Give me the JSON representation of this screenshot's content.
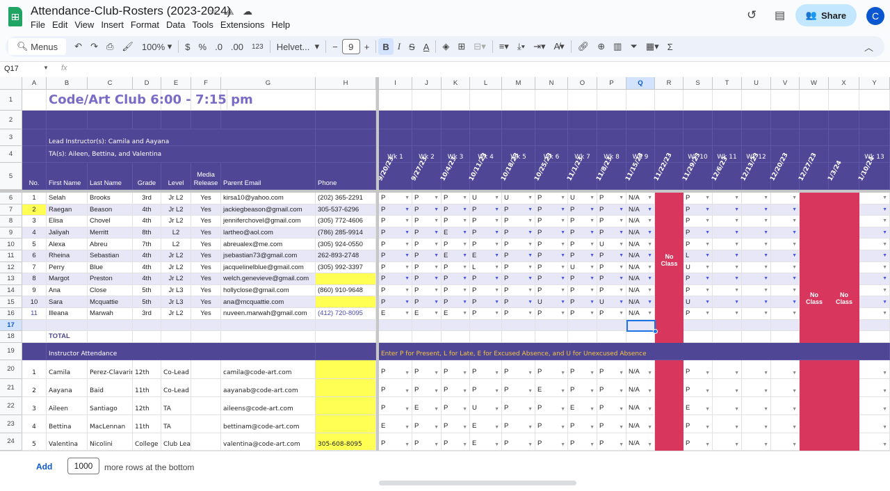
{
  "app": {
    "title": "Attendance-Club-Rosters (2023-2024)",
    "menus": [
      "File",
      "Edit",
      "View",
      "Insert",
      "Format",
      "Data",
      "Tools",
      "Extensions",
      "Help"
    ],
    "share": "Share",
    "avatar": "C"
  },
  "toolbar": {
    "menus": "Menus",
    "zoom": "100%",
    "currency": "$",
    "percent": "%",
    "dec_less": ".0",
    "dec_more": ".00",
    "format_123": "123",
    "font": "Helvet...",
    "font_size": "9",
    "bold": "B",
    "italic": "I",
    "strike": "S",
    "text_color": "A"
  },
  "formula_bar": {
    "cell_ref": "Q17",
    "fx": "fx"
  },
  "columns": [
    "A",
    "B",
    "C",
    "D",
    "E",
    "F",
    "G",
    "H",
    "I",
    "J",
    "K",
    "L",
    "M",
    "N",
    "O",
    "P",
    "Q",
    "R",
    "S",
    "T",
    "U",
    "V",
    "W",
    "X",
    "Y"
  ],
  "rows": [
    "1",
    "2",
    "3",
    "4",
    "5",
    "6",
    "7",
    "8",
    "9",
    "10",
    "11",
    "12",
    "13",
    "14",
    "15",
    "16",
    "17",
    "18",
    "19",
    "20",
    "21",
    "22",
    "23",
    "24"
  ],
  "sheet": {
    "title": "Code/Art Club 6:00 - 7:15 pm",
    "lead": "Lead Instructor(s): Camila and Aayana",
    "tas": "TA(s): Aileen, Bettina, and Valentina",
    "headers": [
      "No.",
      "First Name",
      "Last Name",
      "Grade",
      "Level",
      "Media Release",
      "Parent Email",
      "Phone"
    ],
    "weeks": [
      "Wk 1",
      "Wk 2",
      "Wk 3",
      "Wk 4",
      "Wk 5",
      "Wk 6",
      "Wk 7",
      "Wk 8",
      "Wk 9",
      "",
      "Wk 10",
      "Wk 11",
      "Wk 12",
      "",
      "",
      "",
      "Wk 13"
    ],
    "dates": [
      "9/20/23",
      "9/27/23",
      "10/4/23",
      "10/11/23",
      "10/18/23",
      "10/25/23",
      "11/1/23",
      "11/8/23",
      "11/15/23",
      "11/22/23",
      "11/29/23",
      "12/6/23",
      "12/13/23",
      "12/20/23",
      "12/27/23",
      "1/3/24",
      "1/10/24"
    ],
    "no_class": "No Class",
    "total": "TOTAL",
    "instructor_title": "Instructor Attendance",
    "legend": "Enter P for Present, L for Late, E for Excused Absence, and U for Unexcused Absence",
    "students": [
      {
        "no": "1",
        "first": "Selah",
        "last": "Brooks",
        "grade": "3rd",
        "level": "Jr L2",
        "media": "Yes",
        "email": "kirsa10@yahoo.com",
        "phone": "(202) 365-2291",
        "att": [
          "P",
          "P",
          "P",
          "U",
          "U",
          "P",
          "U",
          "P",
          "N/A"
        ],
        "s": "P"
      },
      {
        "no": "2",
        "first": "Raegan",
        "last": "Beason",
        "grade": "4th",
        "level": "Jr L2",
        "media": "Yes",
        "email": "jackiegbeason@gmail.com",
        "phone": "305-537-6296",
        "att": [
          "P",
          "P",
          "P",
          "P",
          "P",
          "P",
          "P",
          "P",
          "N/A"
        ],
        "s": "P"
      },
      {
        "no": "3",
        "first": "Elisa",
        "last": "Chovel",
        "grade": "4th",
        "level": "Jr L2",
        "media": "Yes",
        "email": "jenniferchovel@gmail.com",
        "phone": "(305) 772-4606",
        "att": [
          "P",
          "P",
          "P",
          "P",
          "P",
          "P",
          "P",
          "P",
          "N/A"
        ],
        "s": "P"
      },
      {
        "no": "4",
        "first": "Jaliyah",
        "last": "Merritt",
        "grade": "8th",
        "level": "L2",
        "media": "Yes",
        "email": "lartheo@aol.com",
        "phone": "(786) 285-9914",
        "att": [
          "P",
          "P",
          "E",
          "P",
          "P",
          "P",
          "P",
          "P",
          "N/A"
        ],
        "s": "P"
      },
      {
        "no": "5",
        "first": "Alexa",
        "last": "Abreu",
        "grade": "7th",
        "level": "L2",
        "media": "Yes",
        "email": "abreualex@me.com",
        "phone": "(305) 924-0550",
        "att": [
          "P",
          "P",
          "P",
          "P",
          "P",
          "P",
          "P",
          "U",
          "N/A"
        ],
        "s": "P"
      },
      {
        "no": "6",
        "first": "Rheina",
        "last": "Sebastian",
        "grade": "4th",
        "level": "Jr L2",
        "media": "Yes",
        "email": "jsebastian73@gmail.com",
        "phone": "262-893-2748",
        "att": [
          "P",
          "P",
          "E",
          "E",
          "P",
          "P",
          "P",
          "P",
          "N/A"
        ],
        "s": "L"
      },
      {
        "no": "7",
        "first": "Perry",
        "last": "Blue",
        "grade": "4th",
        "level": "Jr L2",
        "media": "Yes",
        "email": "jacquelinelblue@gmail.com",
        "phone": "(305) 992-3397",
        "att": [
          "P",
          "P",
          "P",
          "L",
          "P",
          "P",
          "U",
          "P",
          "N/A"
        ],
        "s": "U"
      },
      {
        "no": "8",
        "first": "Margot",
        "last": "Preston",
        "grade": "4th",
        "level": "Jr L2",
        "media": "Yes",
        "email": "welch.genevieve@gmail.com",
        "phone": "",
        "att": [
          "P",
          "P",
          "P",
          "P",
          "P",
          "P",
          "P",
          "P",
          "N/A"
        ],
        "s": "P"
      },
      {
        "no": "9",
        "first": "Ana",
        "last": "Close",
        "grade": "5th",
        "level": "Jr L3",
        "media": "Yes",
        "email": "hollyclose@gmail.com",
        "phone": "(860) 910-9648",
        "att": [
          "P",
          "P",
          "P",
          "P",
          "P",
          "P",
          "P",
          "P",
          "N/A"
        ],
        "s": "P"
      },
      {
        "no": "10",
        "first": "Sara",
        "last": "Mcquattie",
        "grade": "5th",
        "level": "Jr L3",
        "media": "Yes",
        "email": "ana@mcquattie.com",
        "phone": "",
        "att": [
          "P",
          "P",
          "P",
          "P",
          "P",
          "U",
          "P",
          "U",
          "N/A"
        ],
        "s": "U"
      },
      {
        "no": "11",
        "first": "Illeana",
        "last": "Marwah",
        "grade": "3rd",
        "level": "Jr L2",
        "media": "Yes",
        "email": "nuveen.marwah@gmail.com",
        "phone": "(412) 720-8095",
        "att": [
          "E",
          "E",
          "E",
          "P",
          "P",
          "P",
          "P",
          "P",
          "N/A"
        ],
        "s": "P"
      }
    ],
    "instructors": [
      {
        "no": "1",
        "first": "Camila",
        "last": "Perez-Clavarino",
        "grade": "12th",
        "level": "Co-Lead",
        "email": "camila@code-art.com",
        "phone": "",
        "att": [
          "P",
          "P",
          "P",
          "P",
          "P",
          "P",
          "P",
          "P",
          "N/A"
        ],
        "s": "P"
      },
      {
        "no": "2",
        "first": "Aayana",
        "last": "Baid",
        "grade": "11th",
        "level": "Co-Lead",
        "email": "aayanab@code-art.com",
        "phone": "",
        "att": [
          "P",
          "P",
          "P",
          "P",
          "P",
          "E",
          "P",
          "P",
          "N/A"
        ],
        "s": "P"
      },
      {
        "no": "3",
        "first": "Aileen",
        "last": "Santiago",
        "grade": "12th",
        "level": "TA",
        "email": "aileens@code-art.com",
        "phone": "",
        "att": [
          "P",
          "E",
          "P",
          "U",
          "P",
          "P",
          "E",
          "P",
          "N/A"
        ],
        "s": "E"
      },
      {
        "no": "4",
        "first": "Bettina",
        "last": "MacLennan",
        "grade": "11th",
        "level": "TA",
        "email": "bettinam@code-art.com",
        "phone": "",
        "att": [
          "E",
          "P",
          "P",
          "E",
          "P",
          "P",
          "P",
          "P",
          "N/A"
        ],
        "s": "P"
      },
      {
        "no": "5",
        "first": "Valentina",
        "last": "Nicolini",
        "grade": "College",
        "level": "Club Lead",
        "email": "valentina@code-art.com",
        "phone": "305-608-8095",
        "att": [
          "P",
          "P",
          "P",
          "E",
          "P",
          "P",
          "P",
          "P",
          "N/A"
        ],
        "s": "P"
      }
    ]
  },
  "footer": {
    "add": "Add",
    "rows_count": "1000",
    "rows_text": "more rows at the bottom"
  },
  "colors": {
    "purple": "#4f4795",
    "red": "#d8365d",
    "yellow": "#ffff54",
    "lavender": "#e8e7f7",
    "title": "#7a6cc6"
  }
}
